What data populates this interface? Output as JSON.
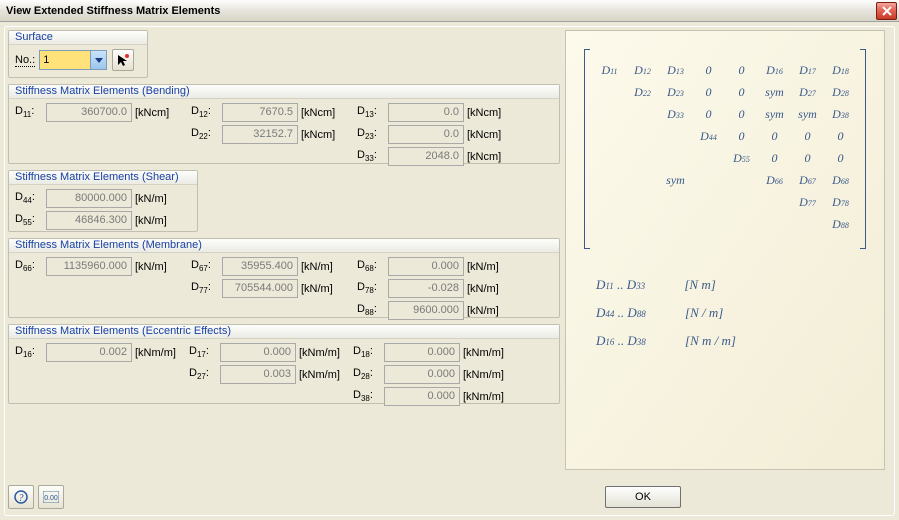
{
  "window": {
    "title": "View Extended Stiffness Matrix Elements"
  },
  "surface": {
    "group_label": "Surface",
    "no_label": "No.:",
    "value": "1"
  },
  "groups": {
    "bending": "Stiffness Matrix Elements (Bending)",
    "shear": "Stiffness Matrix Elements (Shear)",
    "membrane": "Stiffness Matrix Elements (Membrane)",
    "eccentric": "Stiffness Matrix Elements (Eccentric Effects)"
  },
  "labels": {
    "D11": "D11:",
    "D12": "D12:",
    "D13": "D13:",
    "D22": "D22:",
    "D23": "D23:",
    "D33": "D33:",
    "D44": "D44:",
    "D55": "D55:",
    "D66": "D66:",
    "D67": "D67:",
    "D68": "D68:",
    "D77": "D77:",
    "D78": "D78:",
    "D88": "D88:",
    "D16": "D16:",
    "D17": "D17:",
    "D18": "D18:",
    "D27": "D27:",
    "D28": "D28:",
    "D38": "D38:"
  },
  "values": {
    "D11": "360700.0",
    "D12": "7670.5",
    "D13": "0.0",
    "D22": "32152.7",
    "D23": "0.0",
    "D33": "2048.0",
    "D44": "80000.000",
    "D55": "46846.300",
    "D66": "1135960.000",
    "D67": "35955.400",
    "D68": "0.000",
    "D77": "705544.000",
    "D78": "-0.028",
    "D88": "9600.000",
    "D16": "0.002",
    "D17": "0.000",
    "D18": "0.000",
    "D27": "0.003",
    "D28": "0.000",
    "D38": "0.000"
  },
  "units": {
    "kNcm": "[kNcm]",
    "kNm": "[kN/m]",
    "kNm_m": "[kNm/m]"
  },
  "matrix": {
    "cells": [
      [
        "D11",
        "D12",
        "D13",
        "0",
        "0",
        "D16",
        "D17",
        "D18"
      ],
      [
        "",
        "D22",
        "D23",
        "0",
        "0",
        "sym",
        "D27",
        "D28"
      ],
      [
        "",
        "",
        "D33",
        "0",
        "0",
        "sym",
        "sym",
        "D38"
      ],
      [
        "",
        "",
        "",
        "D44",
        "0",
        "0",
        "0",
        "0"
      ],
      [
        "",
        "",
        "",
        "",
        "D55",
        "0",
        "0",
        "0"
      ],
      [
        "",
        "",
        "sym",
        "",
        "",
        "D66",
        "D67",
        "D68"
      ],
      [
        "",
        "",
        "",
        "",
        "",
        "",
        "D77",
        "D78"
      ],
      [
        "",
        "",
        "",
        "",
        "",
        "",
        "",
        "D88"
      ]
    ]
  },
  "legend": {
    "l1a": "D",
    "l1s1": "11",
    "l1b": " .. D",
    "l1s2": "33",
    "l1u": "[N m]",
    "l2a": "D",
    "l2s1": "44",
    "l2b": " .. D",
    "l2s2": "88",
    "l2u": "[N / m]",
    "l3a": "D",
    "l3s1": "16",
    "l3b": " .. D",
    "l3s2": "38",
    "l3u": "[N m / m]"
  },
  "buttons": {
    "ok": "OK"
  }
}
